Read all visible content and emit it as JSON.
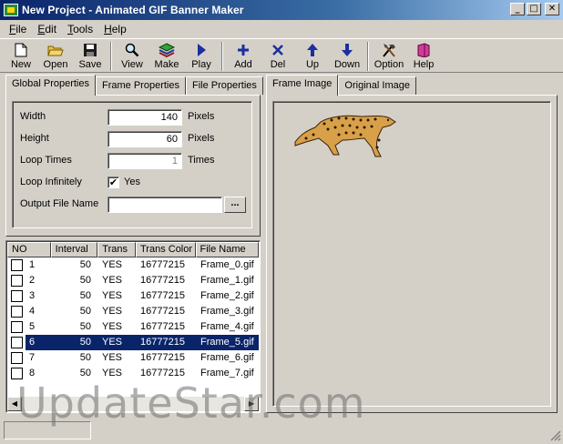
{
  "window": {
    "title": "New Project - Animated GIF Banner Maker",
    "minimize": "_",
    "maximize": "□",
    "close": "✕"
  },
  "menu": [
    {
      "label": "File",
      "key": "F",
      "rest": "ile"
    },
    {
      "label": "Edit",
      "key": "E",
      "rest": "dit"
    },
    {
      "label": "Tools",
      "key": "T",
      "rest": "ools"
    },
    {
      "label": "Help",
      "key": "H",
      "rest": "elp"
    }
  ],
  "toolbar": {
    "new": "New",
    "open": "Open",
    "save": "Save",
    "view": "View",
    "make": "Make",
    "play": "Play",
    "add": "Add",
    "del": "Del",
    "up": "Up",
    "down": "Down",
    "option": "Option",
    "help": "Help"
  },
  "left_tabs": [
    "Global Properties",
    "Frame Properties",
    "File Properties"
  ],
  "right_tabs": [
    "Frame Image",
    "Original Image"
  ],
  "global": {
    "width_label": "Width",
    "width_value": "140",
    "width_unit": "Pixels",
    "height_label": "Height",
    "height_value": "60",
    "height_unit": "Pixels",
    "loop_label": "Loop Times",
    "loop_value": "1",
    "loop_unit": "Times",
    "infinite_label": "Loop Infinitely",
    "infinite_checked": "✔",
    "infinite_text": "Yes",
    "output_label": "Output File Name",
    "output_value": "",
    "browse": "..."
  },
  "frames": {
    "columns": [
      "NO",
      "Interval",
      "Trans",
      "Trans Color",
      "File Name"
    ],
    "rows": [
      {
        "no": "1",
        "interval": "50",
        "trans": "YES",
        "color": "16777215",
        "file": "Frame_0.gif"
      },
      {
        "no": "2",
        "interval": "50",
        "trans": "YES",
        "color": "16777215",
        "file": "Frame_1.gif"
      },
      {
        "no": "3",
        "interval": "50",
        "trans": "YES",
        "color": "16777215",
        "file": "Frame_2.gif"
      },
      {
        "no": "4",
        "interval": "50",
        "trans": "YES",
        "color": "16777215",
        "file": "Frame_3.gif"
      },
      {
        "no": "5",
        "interval": "50",
        "trans": "YES",
        "color": "16777215",
        "file": "Frame_4.gif"
      },
      {
        "no": "6",
        "interval": "50",
        "trans": "YES",
        "color": "16777215",
        "file": "Frame_5.gif"
      },
      {
        "no": "7",
        "interval": "50",
        "trans": "YES",
        "color": "16777215",
        "file": "Frame_6.gif"
      },
      {
        "no": "8",
        "interval": "50",
        "trans": "YES",
        "color": "16777215",
        "file": "Frame_7.gif"
      }
    ],
    "selected_row": "6"
  },
  "scroll": {
    "left": "◀",
    "right": "▶"
  },
  "watermark": "UpdateStar.com",
  "colors": {
    "selection": "#0a246a",
    "face": "#d4d0c8"
  }
}
